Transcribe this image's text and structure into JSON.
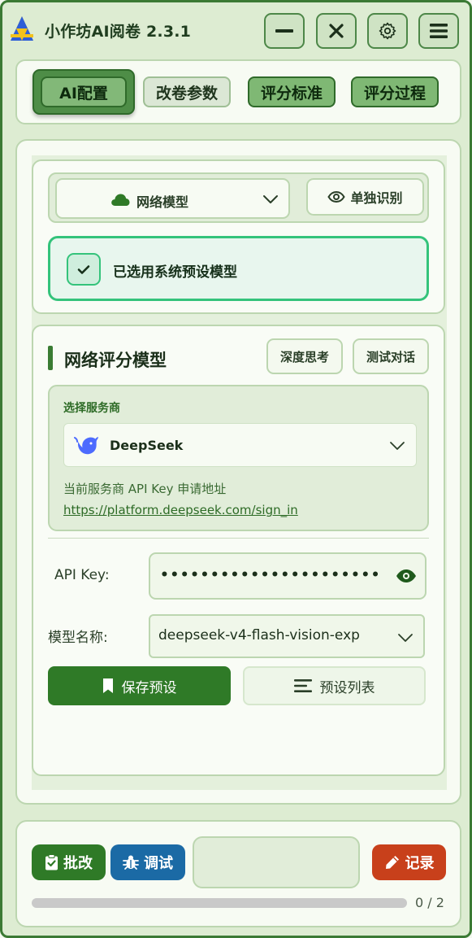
{
  "app": {
    "title": "小作坊AI阅卷 2.3.1"
  },
  "window_controls": {
    "minimize_icon": "minus-icon",
    "close_icon": "x-icon",
    "settings_icon": "gear-icon",
    "menu_icon": "hamburger-icon"
  },
  "tabs": [
    {
      "label": "AI配置",
      "active": true
    },
    {
      "label": "改卷参数",
      "active": false
    },
    {
      "label": "评分标准",
      "active": false
    },
    {
      "label": "评分过程",
      "active": false
    }
  ],
  "model_source": {
    "selected": "网络模型",
    "icon": "cloud-icon",
    "solo_button": "单独识别",
    "solo_icon": "eye-icon"
  },
  "preset_banner": {
    "text": "已选用系统预设模型",
    "checked": true
  },
  "network_model": {
    "section_title": "网络评分模型",
    "deep_think_button": "深度思考",
    "test_chat_button": "测试对话",
    "provider_label": "选择服务商",
    "provider_name": "DeepSeek",
    "provider_icon": "deepseek-whale-icon",
    "api_hint": "当前服务商 API Key 申请地址",
    "api_link": "https://platform.deepseek.com/sign_in",
    "api_key_label": "API Key:",
    "api_key_value": "••••••••••••••••••••••",
    "model_name_label": "模型名称:",
    "model_name_value": "deepseek-v4-flash-vision-exp",
    "save_button": "保存预设",
    "list_button": "预设列表"
  },
  "bottom": {
    "grade_button": "批改",
    "debug_button": "调试",
    "log_button": "记录",
    "progress_done": 0,
    "progress_total": 2,
    "progress_text": "0 / 2"
  },
  "colors": {
    "primary_green": "#2f7a27",
    "tab_green": "#7fb874",
    "success_green": "#34c37b",
    "debug_blue": "#1b6aa5",
    "log_orange": "#c8401b"
  }
}
